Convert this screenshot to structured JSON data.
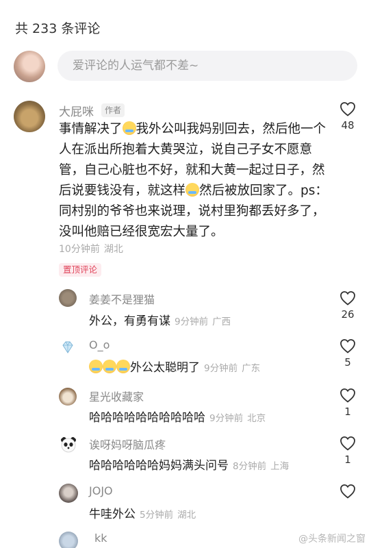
{
  "header": {
    "comment_count": "共 233 条评论"
  },
  "input": {
    "placeholder": "爱评论的人运气都不差~"
  },
  "main_comment": {
    "author": "大屁咪",
    "author_tag": "作者",
    "text_1": "事情解决了",
    "text_2": "我外公叫我妈别回去，然后他一个人在派出所抱着大黄哭泣，说自己子女不愿意管，自己心脏也不好，就和大黄一起过日子，然后说要钱没有，就这样",
    "text_3": "然后被放回家了。ps：同村别的爷爷也来说理，说村里狗都丢好多了，没叫他赔已经很宽宏大量了。",
    "time": "10分钟前",
    "location": "湖北",
    "likes": "48",
    "pinned_label": "置顶评论"
  },
  "replies": [
    {
      "author": "姜姜不是狸猫",
      "text": "外公，有勇有谋",
      "time": "9分钟前",
      "location": "广西",
      "likes": "26"
    },
    {
      "author": "O_o",
      "text": "外公太聪明了",
      "time": "9分钟前",
      "location": "广东",
      "likes": "5"
    },
    {
      "author": "星光收藏家",
      "text": "哈哈哈哈哈哈哈哈哈哈",
      "time": "9分钟前",
      "location": "北京",
      "likes": "1"
    },
    {
      "author": "诶呀妈呀脑瓜疼",
      "text": "哈哈哈哈哈哈妈妈满头问号",
      "time": "8分钟前",
      "location": "上海",
      "likes": "1"
    },
    {
      "author": "JOJO",
      "text": "牛哇外公",
      "time": "5分钟前",
      "location": "湖北",
      "likes": ""
    },
    {
      "author": "kk",
      "text": "",
      "time": "",
      "location": "",
      "likes": ""
    }
  ],
  "watermark": "@头条新闻之窗",
  "colors": {
    "pinned": "#e0455b",
    "meta": "#aaaaaa",
    "name": "#888888"
  }
}
